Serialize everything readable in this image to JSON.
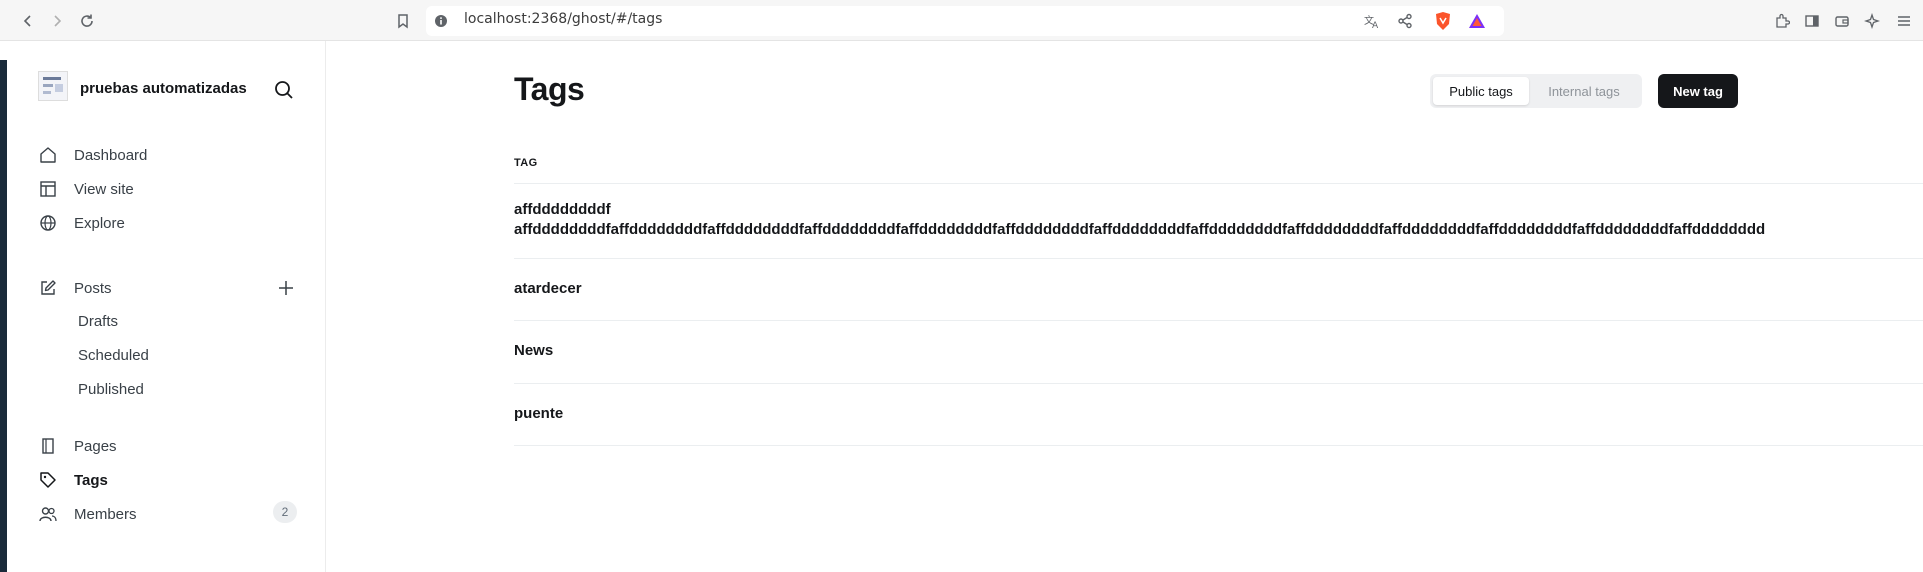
{
  "browser": {
    "url": "localhost:2368/ghost/#/tags"
  },
  "sidebar": {
    "site_title": "pruebas automatizadas",
    "nav": [
      {
        "label": "Dashboard"
      },
      {
        "label": "View site"
      },
      {
        "label": "Explore"
      },
      {
        "label": "Posts"
      },
      {
        "label": "Drafts"
      },
      {
        "label": "Scheduled"
      },
      {
        "label": "Published"
      },
      {
        "label": "Pages"
      },
      {
        "label": "Tags"
      },
      {
        "label": "Members",
        "count": "2"
      }
    ],
    "active": "Tags"
  },
  "main": {
    "title": "Tags",
    "tabs": [
      {
        "label": "Public tags",
        "active": true
      },
      {
        "label": "Internal tags",
        "active": false
      }
    ],
    "new_button": "New tag",
    "column_header": "TAG",
    "tags": [
      {
        "name": "affddddddddf",
        "description": "affddddddddfaffddddddddfaffddddddddfaffddddddddfaffddddddddfaffddddddddfaffddddddddfaffddddddddfaffddddddddfaffddddddddfaffddddddddfaffddddddddfaffdddddddd"
      },
      {
        "name": "atardecer"
      },
      {
        "name": "News"
      },
      {
        "name": "puente"
      }
    ]
  },
  "colors": {
    "primary": "#15171a",
    "muted": "#8e9399",
    "border": "#ebeef0"
  }
}
